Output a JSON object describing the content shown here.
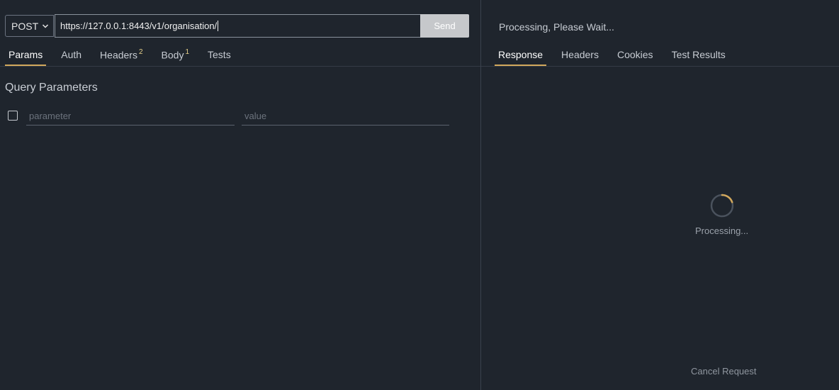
{
  "request": {
    "method": "POST",
    "url": "https://127.0.0.1:8443/v1/organisation/",
    "send_label": "Send"
  },
  "request_tabs": [
    {
      "label": "Params",
      "badge": ""
    },
    {
      "label": "Auth",
      "badge": ""
    },
    {
      "label": "Headers",
      "badge": "2"
    },
    {
      "label": "Body",
      "badge": "1"
    },
    {
      "label": "Tests",
      "badge": ""
    }
  ],
  "params": {
    "title": "Query Parameters",
    "parameter_placeholder": "parameter",
    "value_placeholder": "value"
  },
  "response": {
    "status": "Processing, Please Wait...",
    "processing_label": "Processing...",
    "cancel_label": "Cancel Request"
  },
  "response_tabs": [
    {
      "label": "Response"
    },
    {
      "label": "Headers"
    },
    {
      "label": "Cookies"
    },
    {
      "label": "Test Results"
    }
  ],
  "colors": {
    "background": "#1f252d",
    "accent": "#d2a85c",
    "send_button": "#c6c8cb"
  },
  "icons": {
    "method_dropdown": "chevron-down-icon",
    "spinner": "loading-spinner-icon",
    "param_checkbox": "checkbox-icon"
  }
}
